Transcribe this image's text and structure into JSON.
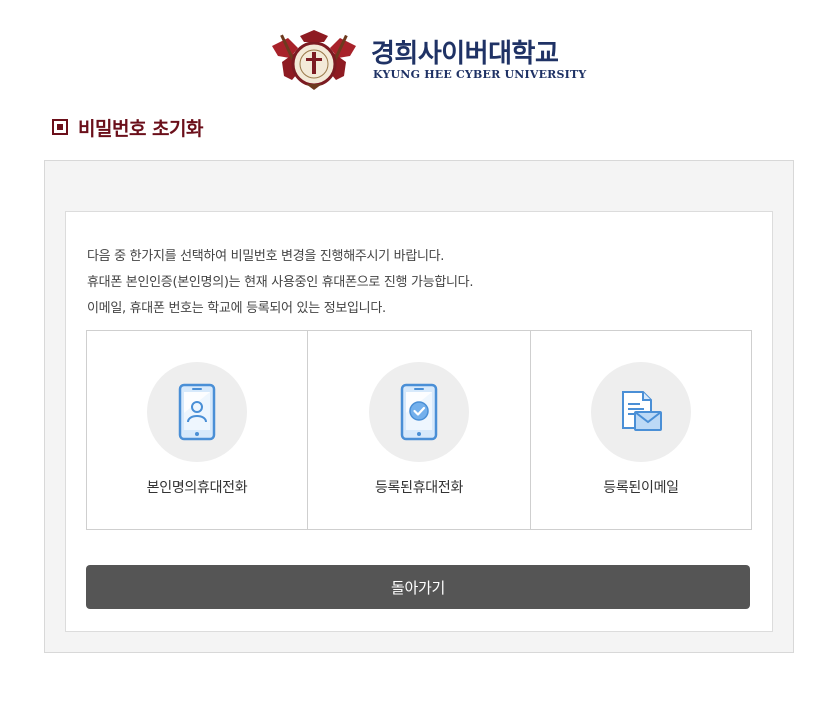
{
  "logo": {
    "korean": "경희사이버대학교",
    "english": "KYUNG HEE CYBER UNIVERSITY",
    "emblem_icon": "university-crest"
  },
  "page": {
    "title": "비밀번호 초기화"
  },
  "description": [
    "다음 중 한가지를 선택하여 비밀번호 변경을 진행해주시기 바랍니다.",
    "휴대폰 본인인증(본인명의)는 현재 사용중인 휴대폰으로 진행 가능합니다.",
    "이메일, 휴대폰 번호는 학교에 등록되어 있는 정보입니다."
  ],
  "options": [
    {
      "label": "본인명의휴대전화",
      "icon": "phone-user-icon"
    },
    {
      "label": "등록된휴대전화",
      "icon": "phone-check-icon"
    },
    {
      "label": "등록된이메일",
      "icon": "email-document-icon"
    }
  ],
  "back_button": {
    "label": "돌아가기"
  },
  "colors": {
    "brand_navy": "#1f3265",
    "title_maroon": "#6b0f1a",
    "button_gray": "#555555",
    "icon_blue": "#4a8fd6"
  }
}
